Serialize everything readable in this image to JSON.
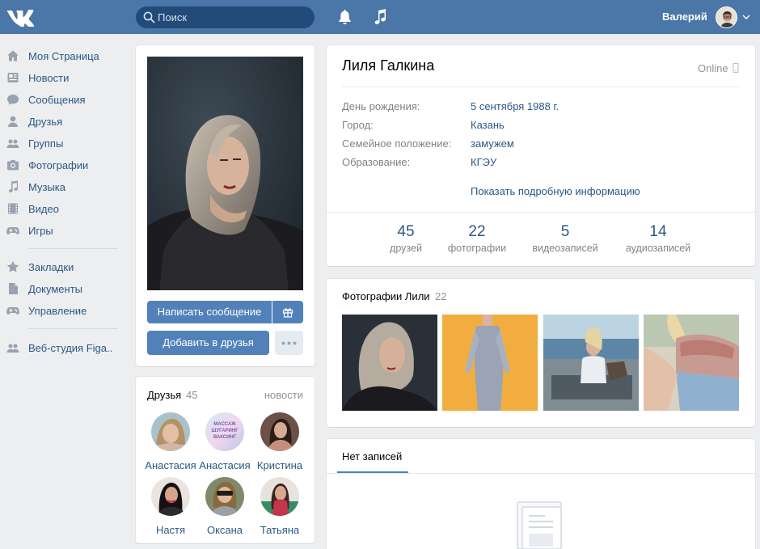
{
  "header": {
    "search_placeholder": "Поиск",
    "user_name": "Валерий"
  },
  "sidebar": {
    "items": [
      {
        "label": "Моя Страница",
        "icon": "home-icon"
      },
      {
        "label": "Новости",
        "icon": "news-icon"
      },
      {
        "label": "Сообщения",
        "icon": "messages-icon"
      },
      {
        "label": "Друзья",
        "icon": "user-icon"
      },
      {
        "label": "Группы",
        "icon": "groups-icon"
      },
      {
        "label": "Фотографии",
        "icon": "camera-icon"
      },
      {
        "label": "Музыка",
        "icon": "music-icon"
      },
      {
        "label": "Видео",
        "icon": "video-icon"
      },
      {
        "label": "Игры",
        "icon": "gamepad-icon"
      },
      {
        "label": "Закладки",
        "icon": "star-icon"
      },
      {
        "label": "Документы",
        "icon": "document-icon"
      },
      {
        "label": "Управление",
        "icon": "gamepad-icon"
      },
      {
        "label": "Веб-студия Figa..",
        "icon": "groups-icon"
      }
    ]
  },
  "profile": {
    "name": "Лиля Галкина",
    "status": "Online",
    "buttons": {
      "message": "Написать сообщение",
      "add_friend": "Добавить в друзья"
    },
    "info": [
      {
        "label": "День рождения:",
        "value": "5 сентября 1988 г."
      },
      {
        "label": "Город:",
        "value": "Казань"
      },
      {
        "label": "Семейное положение:",
        "value": "замужем"
      },
      {
        "label": "Образование:",
        "value": "КГЭУ"
      }
    ],
    "show_more": "Показать подробную информацию",
    "counters": [
      {
        "num": "45",
        "label": "друзей"
      },
      {
        "num": "22",
        "label": "фотографии"
      },
      {
        "num": "5",
        "label": "видеозаписей"
      },
      {
        "num": "14",
        "label": "аудиозаписей"
      }
    ]
  },
  "friends_block": {
    "title": "Друзья",
    "count": "45",
    "link": "новости",
    "friends": [
      {
        "name": "Анастасия"
      },
      {
        "name": "Анастасия",
        "avatar_text": "МАССАЖ ШУГАРИНГ ВАКСИНГ"
      },
      {
        "name": "Кристина"
      },
      {
        "name": "Настя"
      },
      {
        "name": "Оксана"
      },
      {
        "name": "Татьяна"
      }
    ]
  },
  "photos_block": {
    "title": "Фотографии Лили",
    "count": "22"
  },
  "wall": {
    "tab": "Нет записей"
  },
  "colors": {
    "header": "#4a76a8",
    "link": "#2a5885",
    "button": "#5181b8",
    "background": "#edeef0"
  }
}
